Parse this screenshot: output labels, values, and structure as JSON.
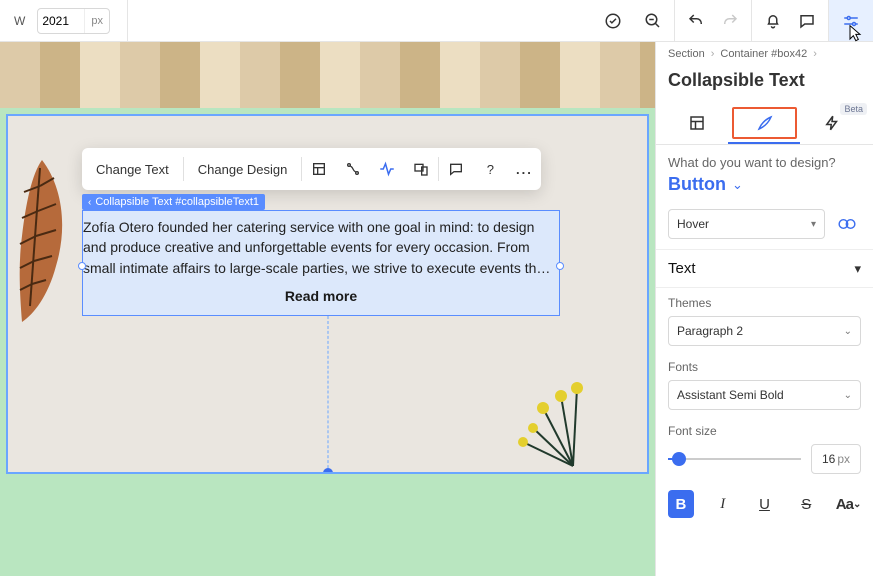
{
  "topbar": {
    "width_label": "W",
    "width_value": "2021",
    "width_unit": "px"
  },
  "panel": {
    "breadcrumbs": [
      "Section",
      "Container #box42"
    ],
    "title": "Collapsible Text",
    "beta": "Beta",
    "question": "What do you want to design?",
    "target": "Button",
    "state_selected": "Hover",
    "accordion": "Text",
    "themes_label": "Themes",
    "theme_selected": "Paragraph 2",
    "fonts_label": "Fonts",
    "font_selected": "Assistant Semi Bold",
    "fontsize_label": "Font size",
    "fontsize_value": "16",
    "fontsize_unit": "px",
    "fmt_bold": "B",
    "fmt_italic": "I",
    "fmt_underline": "U",
    "fmt_strike": "S",
    "fmt_caps": "Aa"
  },
  "floatbar": {
    "change_text": "Change Text",
    "change_design": "Change Design",
    "help": "?",
    "more": "..."
  },
  "selection": {
    "tag": "Collapsible Text #collapsibleText1",
    "paragraph": "Zofía Otero founded her catering service with one goal in mind: to design and produce creative and unforgettable events for every occasion. From small intimate affairs to large-scale parties, we strive to execute events th…",
    "read_more": "Read more"
  }
}
